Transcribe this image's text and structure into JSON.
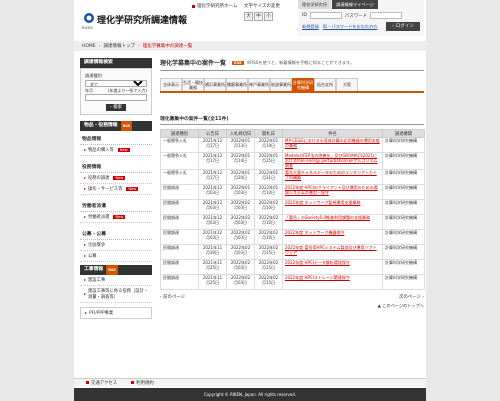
{
  "header": {
    "org": "理化学研究所調達情報",
    "logo_mini": "RIKEN",
    "links": [
      "理化学研究所ホーム",
      "文字サイズの変更"
    ],
    "font_sizes": [
      "大",
      "中",
      "小"
    ],
    "login_tabs": [
      "理化学研究所",
      "調達情報マイページ"
    ],
    "id_label": "ID",
    "password_label": "パスワード",
    "register_link": "新規登録",
    "forgot_link": "ID・パスワードをお忘れの方",
    "login_button": "ログイン"
  },
  "breadcrumb": {
    "home": "HOME",
    "parent": "調達情報トップ",
    "current": "理化学募集中の調達一覧"
  },
  "sidebar": {
    "search_title": "調達情報検索",
    "cat_label": "調達種別",
    "cat_value": "全て",
    "year_label": "年月",
    "year_hint": "(年度より一桁で入力)",
    "search_btn": "検索",
    "supply_title": "物品・役務情報",
    "supply_sec": "物品情報",
    "supply_item": "物品の購入等",
    "construct_sec": "役務情報",
    "construct_items": [
      "役務の調達",
      "操作・サービス等"
    ],
    "labor_sec": "労働者派遣",
    "labor_item": "労働者派遣",
    "public_sec": "公募・公募",
    "public_items": [
      "企画競争",
      "公募"
    ],
    "work_title": "工事情報",
    "work_items": [
      "建設工事",
      "建設工事等に係る役務（設計・測量・調査等）"
    ],
    "pfi": "PFI/PPP事業",
    "rss": "RSS",
    "new": "New"
  },
  "main": {
    "title": "理化学募集中の案件一覧",
    "rss": "RSS",
    "note": "※RSSを使うと、新着情報を手軽に知ることができます。",
    "tabs": [
      "全体表示",
      "生活・駆技業務",
      "横浜事業所",
      "播磨事業所",
      "神戸事業所",
      "筑波事業所",
      "計算科学研究機構",
      "仙台支所",
      "大阪"
    ],
    "active_tab": 6,
    "list_title": "理化募集中の案件一覧(全11件)",
    "columns": [
      "調達種別",
      "公告日",
      "入札締切日",
      "開札日",
      "件名",
      "調達機関"
    ],
    "rows": [
      {
        "type": "一般競争入札",
        "pub": "2021年12月17日",
        "deadline": "2022年01月13日",
        "open": "2022年01月19日",
        "title": "MP-CESiEにおける半導体計算の応用機器の運用支援の業務",
        "org": "計算科学研究機構"
      },
      {
        "type": "一般競争入札",
        "pub": "2021年12月17日",
        "deadline": "2022年01月14日",
        "open": "2022年01月25日",
        "title": "ModelsのFEP法の改善化，及びGROMACS2021におけるfree energy perturbationFEPアルゴリズム調査",
        "org": "計算科学研究機構"
      },
      {
        "type": "一般競争入札",
        "pub": "2021年12月17日",
        "deadline": "2022年01月20日",
        "open": "2022年01月31日",
        "title": "富岳大量チャネルデータのためのランタンアーカイブの構築",
        "org": "計算科学研究機構"
      },
      {
        "type": "民間調達",
        "pub": "2021年12月03日",
        "deadline": "2022年01月03日",
        "open": "2022年01月10日",
        "title": "2022年度 HPCIのクライアント及び運用のための環境システムの運用・保守",
        "org": "計算科学研究機構"
      },
      {
        "type": "民間調達",
        "pub": "2021年12月03日",
        "deadline": "2022年02月03日",
        "open": "2022年02月10日",
        "title": "2022年度 ネットワーク監視運用支援業務",
        "org": "計算科学研究機構"
      },
      {
        "type": "民間調達",
        "pub": "2021年12月03日",
        "deadline": "2022年02月03日",
        "open": "2022年02月10日",
        "title": "「富岳」のSociety5.0推進利用課題の支援業務",
        "org": "計算科学研究機構"
      },
      {
        "type": "民間調達",
        "pub": "2021年12月03日",
        "deadline": "2022年02月03日",
        "open": "2022年02月10日",
        "title": "2022年度 ネットワーク機器保守",
        "org": "計算科学研究機構"
      },
      {
        "type": "民間調達",
        "pub": "2021年11月30日",
        "deadline": "2022年02月03日",
        "open": "2022年02月15日",
        "title": "2022年度 富岳用HPCシステム製造及び運用ソフトウェア",
        "org": "計算科学研究機構"
      },
      {
        "type": "民間調達",
        "pub": "2021年11月25日",
        "deadline": "2022年02月03日",
        "open": "2022年02月15日",
        "title": "2022年度 HPCIデータ解析環境保守",
        "org": "計算科学研究機構"
      },
      {
        "type": "民間調達",
        "pub": "2021年11月25日",
        "deadline": "2022年02月03日",
        "open": "2022年02月15日",
        "title": "2022年度 HPCIストレージ関連保守",
        "org": "計算科学研究機構"
      }
    ],
    "prev": "前のページ",
    "next": "次のページ",
    "totop": "このページのトップへ"
  },
  "footer": {
    "links": [
      "交通アクセス",
      "利用規約"
    ],
    "copyright": "Copyright © RIKEN, Japan. All rights reserved."
  }
}
